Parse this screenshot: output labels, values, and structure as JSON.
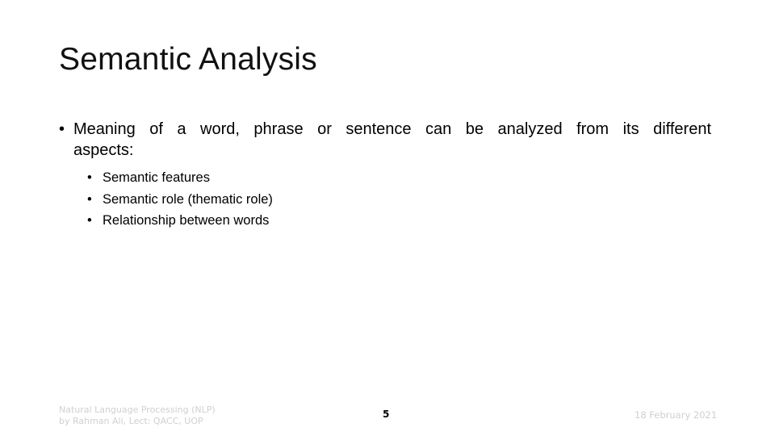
{
  "slide": {
    "title": "Semantic Analysis",
    "bullets": [
      {
        "text": "Meaning of a word, phrase or sentence can be analyzed from its different aspects:",
        "sub_bullets": [
          "Semantic features",
          "Semantic role (thematic role)",
          "Relationship between words"
        ]
      }
    ],
    "bullet_glyph": "•"
  },
  "footer": {
    "left_line1": "Natural Language Processing (NLP)",
    "left_line2": "by Rahman Ali, Lect: QACC, UOP",
    "page_number": "5",
    "date": "18 February 2021"
  }
}
